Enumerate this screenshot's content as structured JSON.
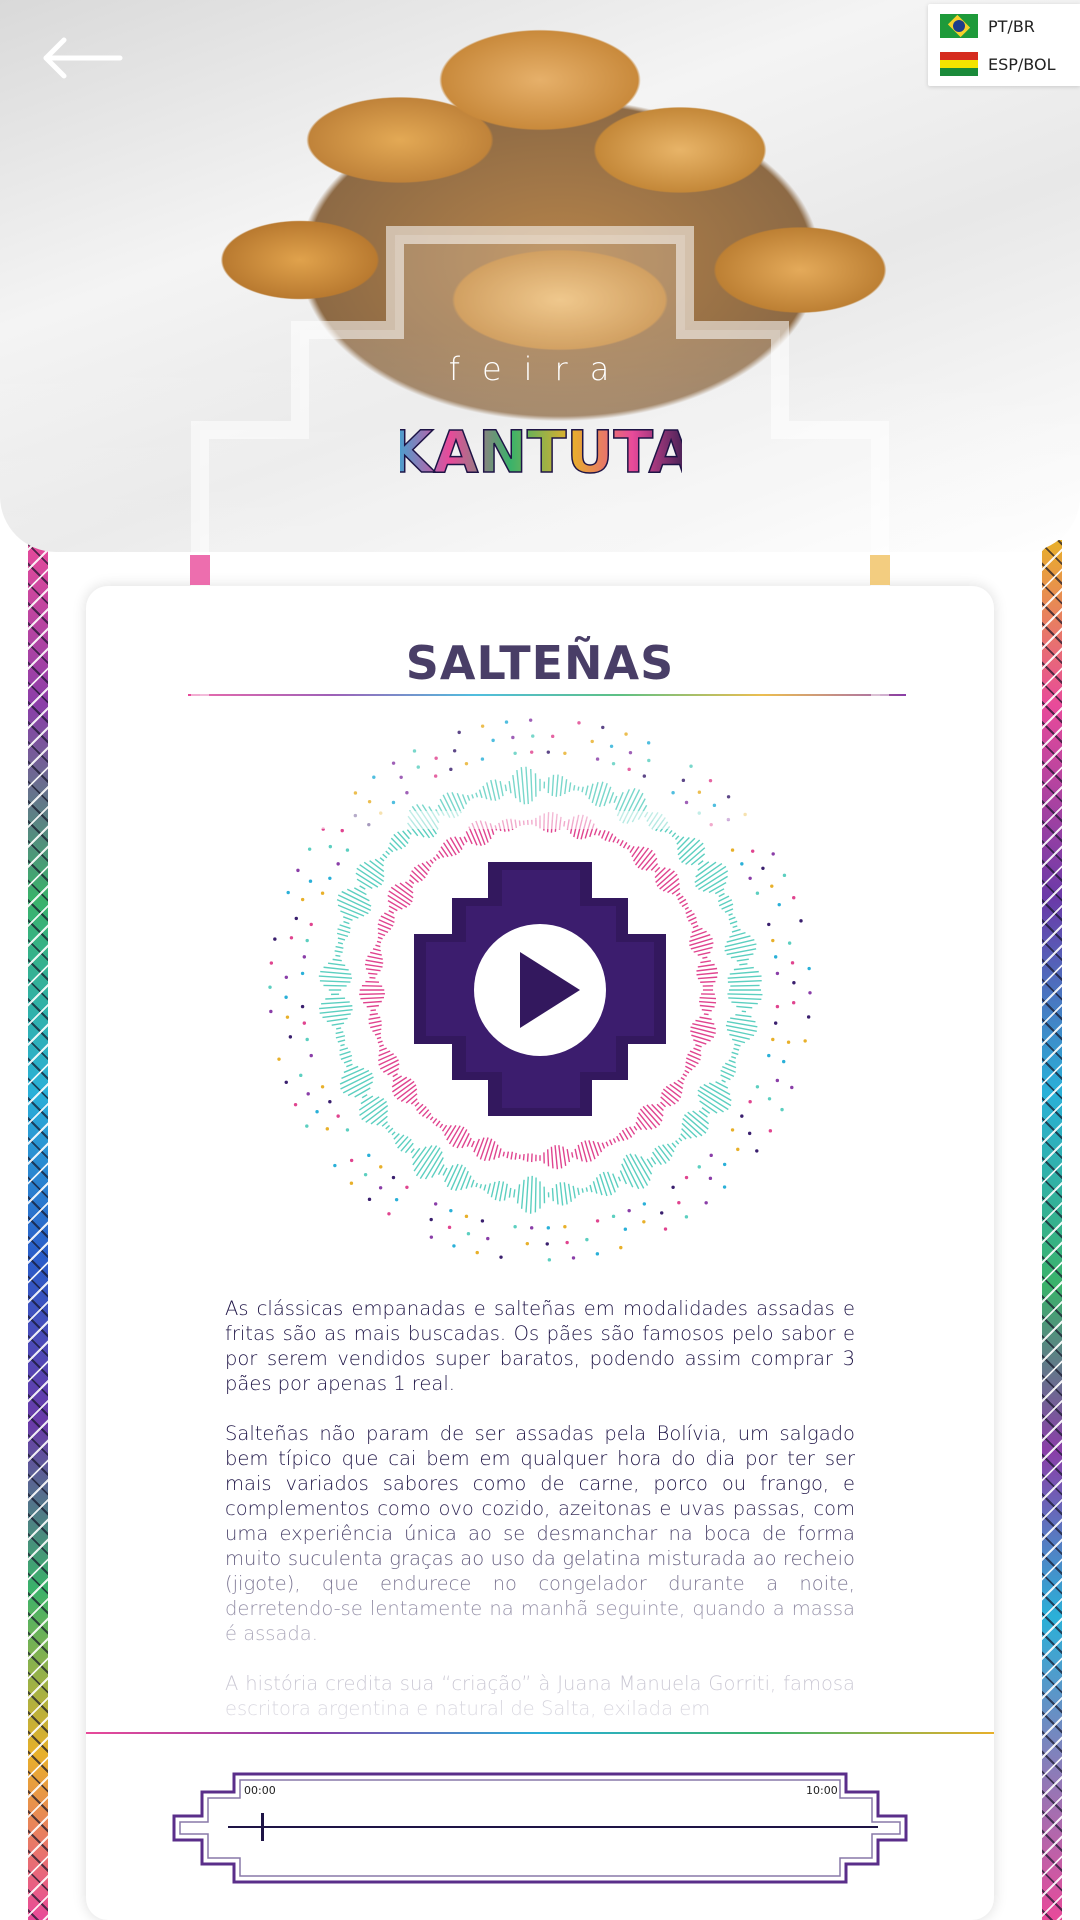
{
  "header": {
    "languages": [
      {
        "code": "PT/BR",
        "flag": "brazil-flag-icon"
      },
      {
        "code": "ESP/BOL",
        "flag": "bolivia-flag-icon"
      }
    ],
    "back_icon": "back-arrow-icon"
  },
  "brand": {
    "feira": "feira",
    "logo_text": "KANTUTA"
  },
  "article": {
    "title": "SALTEÑAS",
    "paragraphs": [
      "As clássicas empanadas e salteñas em modalidades assadas e fritas são as mais buscadas. Os pães são famosos pelo sabor e por serem vendidos super baratos, podendo assim comprar 3 pães por apenas 1 real.",
      "Salteñas não param de ser assadas pela Bolívia, um salgado bem típico que cai bem em qualquer hora do dia por ter ser mais variados sabores como de carne, porco ou frango, e complementos como ovo cozido, azeitonas e uvas passas, com uma experiência única ao se desmanchar na boca de forma muito suculenta graças ao uso da gelatina misturada ao recheio (jigote), que endurece no congelador durante a noite, derretendo-se lentamente na manhã seguinte, quando a massa é assada.",
      "A história credita sua “criação” à Juana Manuela Gorriti, famosa escritora argentina e natural de Salta, exilada em"
    ]
  },
  "player": {
    "current_time": "00:00",
    "total_time": "10:00",
    "progress": 0.05,
    "play_icon": "play-icon"
  },
  "colors": {
    "accent_purple": "#3a1f6e",
    "title_navy": "#221446",
    "wave_teal": "#5ccfc0",
    "wave_pink": "#e0448f"
  }
}
